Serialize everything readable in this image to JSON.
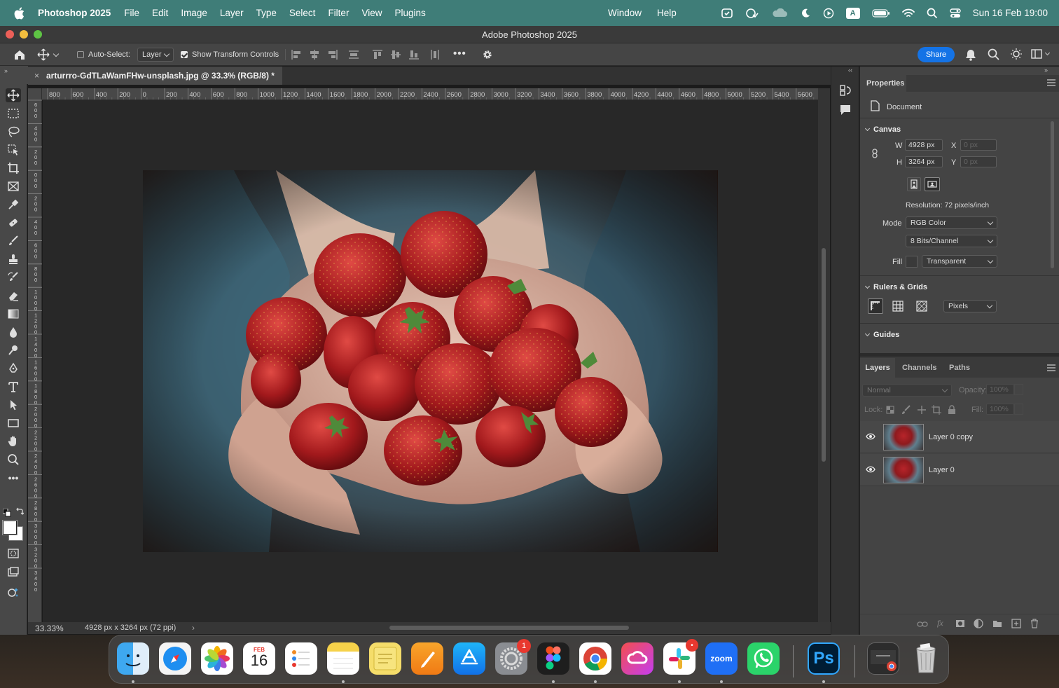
{
  "menubar": {
    "app_name": "Photoshop 2025",
    "items": [
      "File",
      "Edit",
      "Image",
      "Layer",
      "Type",
      "Select",
      "Filter",
      "View",
      "Plugins"
    ],
    "right_items": [
      "Window",
      "Help"
    ],
    "datetime": "Sun 16 Feb  19:00",
    "input_source": "A"
  },
  "window": {
    "title": "Adobe Photoshop 2025"
  },
  "options_bar": {
    "auto_select_label": "Auto-Select:",
    "auto_select_checked": false,
    "auto_select_target": "Layer",
    "show_transform_label": "Show Transform Controls",
    "show_transform_checked": true,
    "share_label": "Share",
    "more_label": "•••"
  },
  "document": {
    "tab_title": "arturrro-GdTLaWamFHw-unsplash.jpg @ 33.3% (RGB/8) *",
    "zoom": "33.33%",
    "info": "4928 px x 3264 px (72 ppi)"
  },
  "ruler": {
    "h_labels": [
      "800",
      "600",
      "400",
      "200",
      "0",
      "200",
      "400",
      "600",
      "800",
      "1000",
      "1200",
      "1400",
      "1600",
      "1800",
      "2000",
      "2200",
      "2400",
      "2600",
      "2800",
      "3000",
      "3200",
      "3400",
      "3600",
      "3800",
      "4000",
      "4200",
      "4400",
      "4600",
      "4800",
      "5000",
      "5200",
      "5400",
      "5600"
    ],
    "v_labels": [
      "6",
      "4",
      "2",
      "0",
      "2",
      "4",
      "6",
      "8",
      "10",
      "12",
      "14",
      "16",
      "18",
      "20",
      "22",
      "24",
      "26",
      "28",
      "30",
      "32",
      "34"
    ]
  },
  "properties": {
    "title": "Properties",
    "doc_label": "Document",
    "canvas_label": "Canvas",
    "w_label": "W",
    "w_value": "4928 px",
    "h_label": "H",
    "h_value": "3264 px",
    "x_label": "X",
    "x_placeholder": "0 px",
    "y_label": "Y",
    "y_placeholder": "0 px",
    "resolution": "Resolution: 72 pixels/inch",
    "mode_label": "Mode",
    "mode_value": "RGB Color",
    "bits_value": "8 Bits/Channel",
    "fill_label": "Fill",
    "fill_value": "Transparent",
    "rulers_label": "Rulers & Grids",
    "units_value": "Pixels",
    "guides_label": "Guides"
  },
  "layers_panel": {
    "tabs": [
      "Layers",
      "Channels",
      "Paths"
    ],
    "blend_mode": "Normal",
    "opacity_label": "Opacity:",
    "opacity_value": "100%",
    "lock_label": "Lock:",
    "fill_label": "Fill:",
    "fill_value": "100%",
    "layers": [
      {
        "name": "Layer 0 copy"
      },
      {
        "name": "Layer 0"
      }
    ]
  },
  "dock": {
    "calendar_month": "FEB",
    "calendar_day": "16",
    "settings_badge": "1",
    "zoom_label": "zoom",
    "ps_label": "Ps"
  },
  "colors": {
    "menubar": "#3f7d78",
    "share": "#1473e6",
    "badge": "#e8382f"
  }
}
